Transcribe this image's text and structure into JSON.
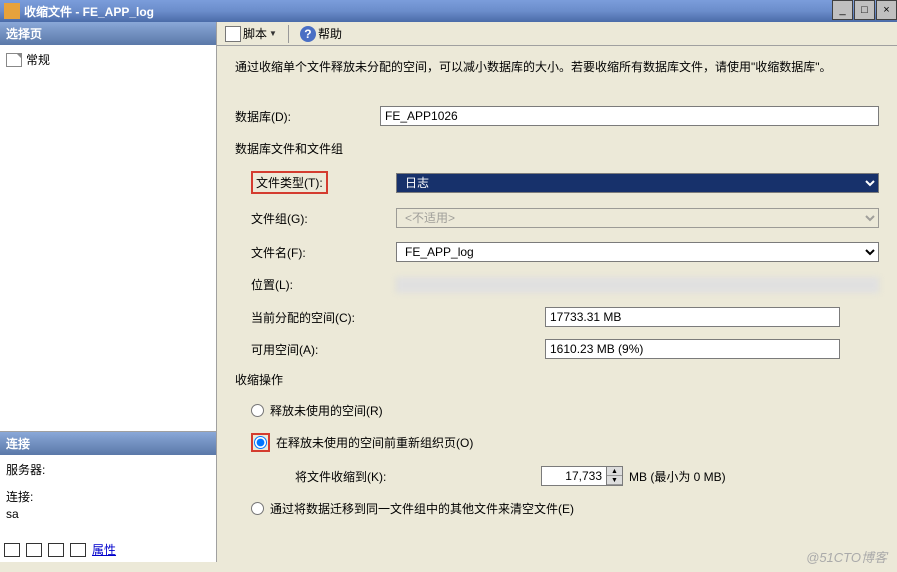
{
  "window": {
    "title": "收缩文件 - FE_APP_log",
    "min": "_",
    "max": "□",
    "close": "×"
  },
  "sidebar": {
    "select_header": "选择页",
    "tree_item": "常规",
    "conn_header": "连接",
    "server_label": "服务器:",
    "server_value": " ",
    "conn_label": "连接:",
    "conn_value": "sa",
    "props_link": "属性"
  },
  "toolbar": {
    "script": "脚本",
    "help": "帮助"
  },
  "body": {
    "description": "通过收缩单个文件释放未分配的空间，可以减小数据库的大小。若要收缩所有数据库文件，请使用\"收缩数据库\"。",
    "db_label": "数据库(D):",
    "db_value": "FE_APP1026",
    "group_title": "数据库文件和文件组",
    "filetype_label": "文件类型(T):",
    "filetype_value": "日志",
    "filegroup_label": "文件组(G):",
    "filegroup_value": "<不适用>",
    "filename_label": "文件名(F):",
    "filename_value": "FE_APP_log",
    "location_label": "位置(L):",
    "alloc_label": "当前分配的空间(C):",
    "alloc_value": "17733.31 MB",
    "free_label": "可用空间(A):",
    "free_value": "1610.23 MB (9%)",
    "shrink_title": "收缩操作",
    "radio1": "释放未使用的空间(R)",
    "radio2": "在释放未使用的空间前重新组织页(O)",
    "shrink_to_label": "将文件收缩到(K):",
    "shrink_to_value": "17,733",
    "shrink_to_suffix": "MB  (最小为 0 MB)",
    "radio3": "通过将数据迁移到同一文件组中的其他文件来清空文件(E)"
  },
  "watermark": "@51CTO博客"
}
